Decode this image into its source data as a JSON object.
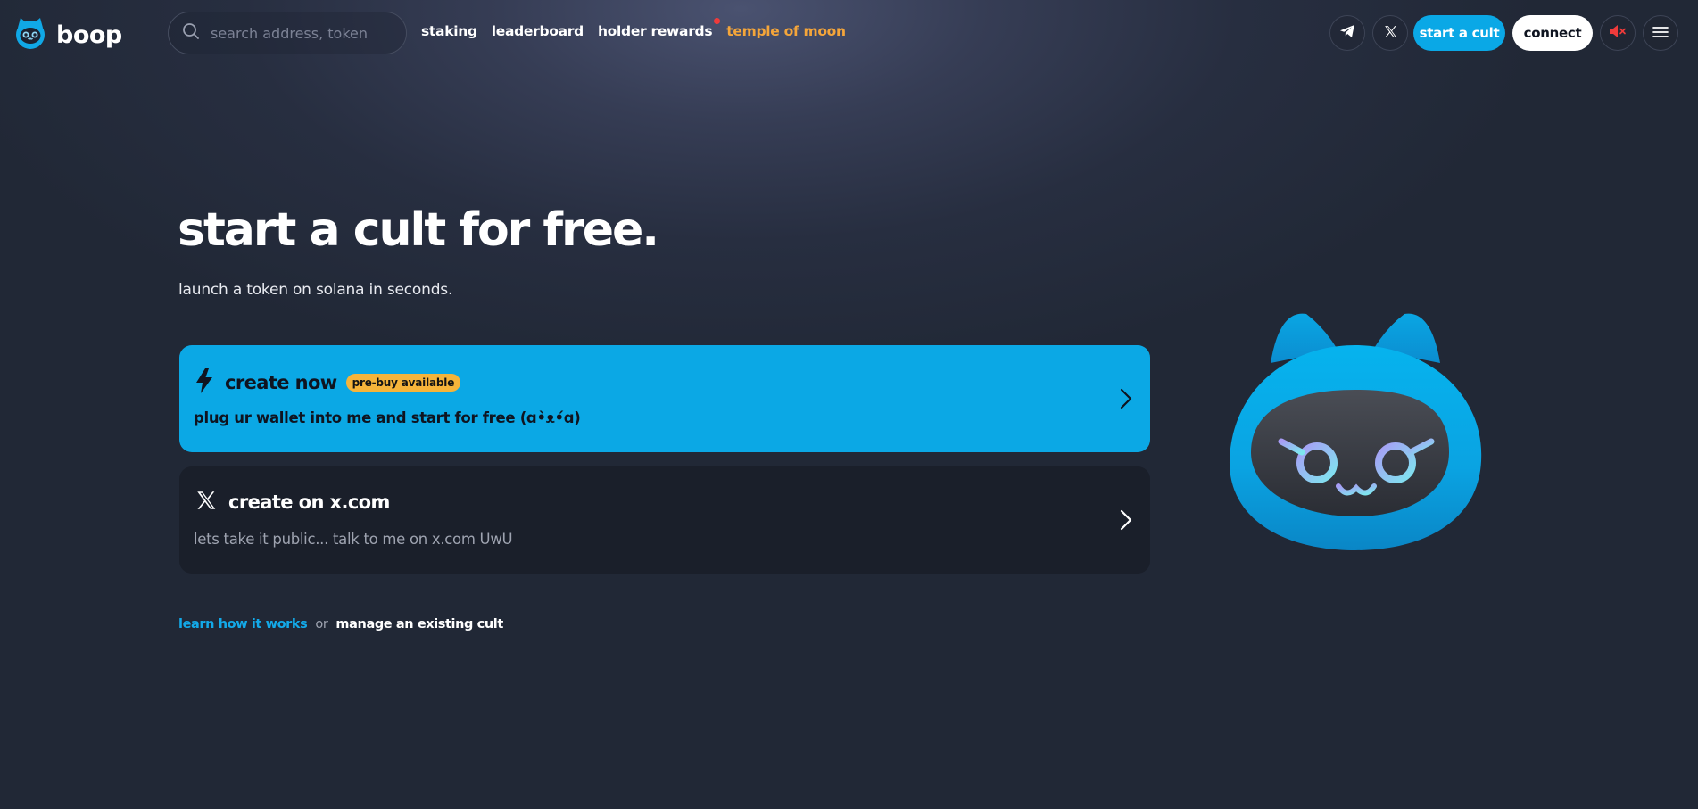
{
  "header": {
    "brand": "boop",
    "search_placeholder": "search address, token",
    "nav": {
      "staking": "staking",
      "leaderboard": "leaderboard",
      "holder_rewards": "holder rewards",
      "temple_of_moon": "temple of moon"
    },
    "start_cult_label": "start a cult",
    "connect_label": "connect",
    "icons": [
      "telegram-icon",
      "x-icon",
      "mute-icon",
      "menu-icon"
    ]
  },
  "hero": {
    "title": "start a cult for free.",
    "subtitle": "launch a token on solana in seconds."
  },
  "cards": {
    "create_now": {
      "title": "create now",
      "badge": "pre-buy available",
      "description": "plug ur wallet into me and start for free (ɑ•̀ᴥ•́ɑ)"
    },
    "create_x": {
      "title": "create on x.com",
      "description": "lets take it public... talk to me on x.com UwU"
    }
  },
  "footer": {
    "learn": "learn how it works",
    "or": "or",
    "manage": "manage an existing cult"
  },
  "colors": {
    "accent": "#0ba8e5",
    "orange": "#f4a53a",
    "badge": "#f6b43a",
    "notification": "#ef3b3b",
    "mute_red": "#ef3b3b"
  }
}
